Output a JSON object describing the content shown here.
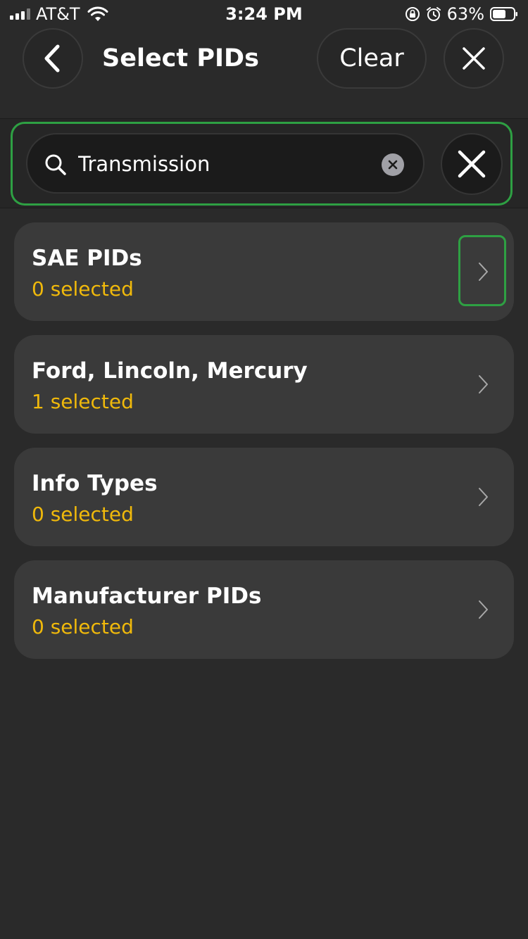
{
  "status_bar": {
    "carrier": "AT&T",
    "time": "3:24 PM",
    "battery_percent": "63%",
    "icons": [
      "signal-icon",
      "wifi-icon",
      "orientation-lock-icon",
      "alarm-icon",
      "battery-icon"
    ]
  },
  "nav": {
    "title": "Select PIDs",
    "clear_label": "Clear",
    "back_icon": "chevron-left-icon",
    "close_icon": "close-icon"
  },
  "search": {
    "value": "Transmission",
    "placeholder": "",
    "icon": "search-icon",
    "clear_icon": "clear-text-icon",
    "cancel_icon": "close-icon"
  },
  "categories": [
    {
      "title": "SAE PIDs",
      "subtitle": "0 selected",
      "highlighted": true
    },
    {
      "title": "Ford, Lincoln, Mercury",
      "subtitle": "1 selected",
      "highlighted": false
    },
    {
      "title": "Info Types",
      "subtitle": "0 selected",
      "highlighted": false
    },
    {
      "title": "Manufacturer PIDs",
      "subtitle": "0 selected",
      "highlighted": false
    }
  ],
  "colors": {
    "background": "#2a2a2a",
    "card": "#3a3a3a",
    "accent_selected_text": "#f0b90b",
    "highlight_outline": "#2ea043",
    "text_primary": "#ffffff"
  }
}
